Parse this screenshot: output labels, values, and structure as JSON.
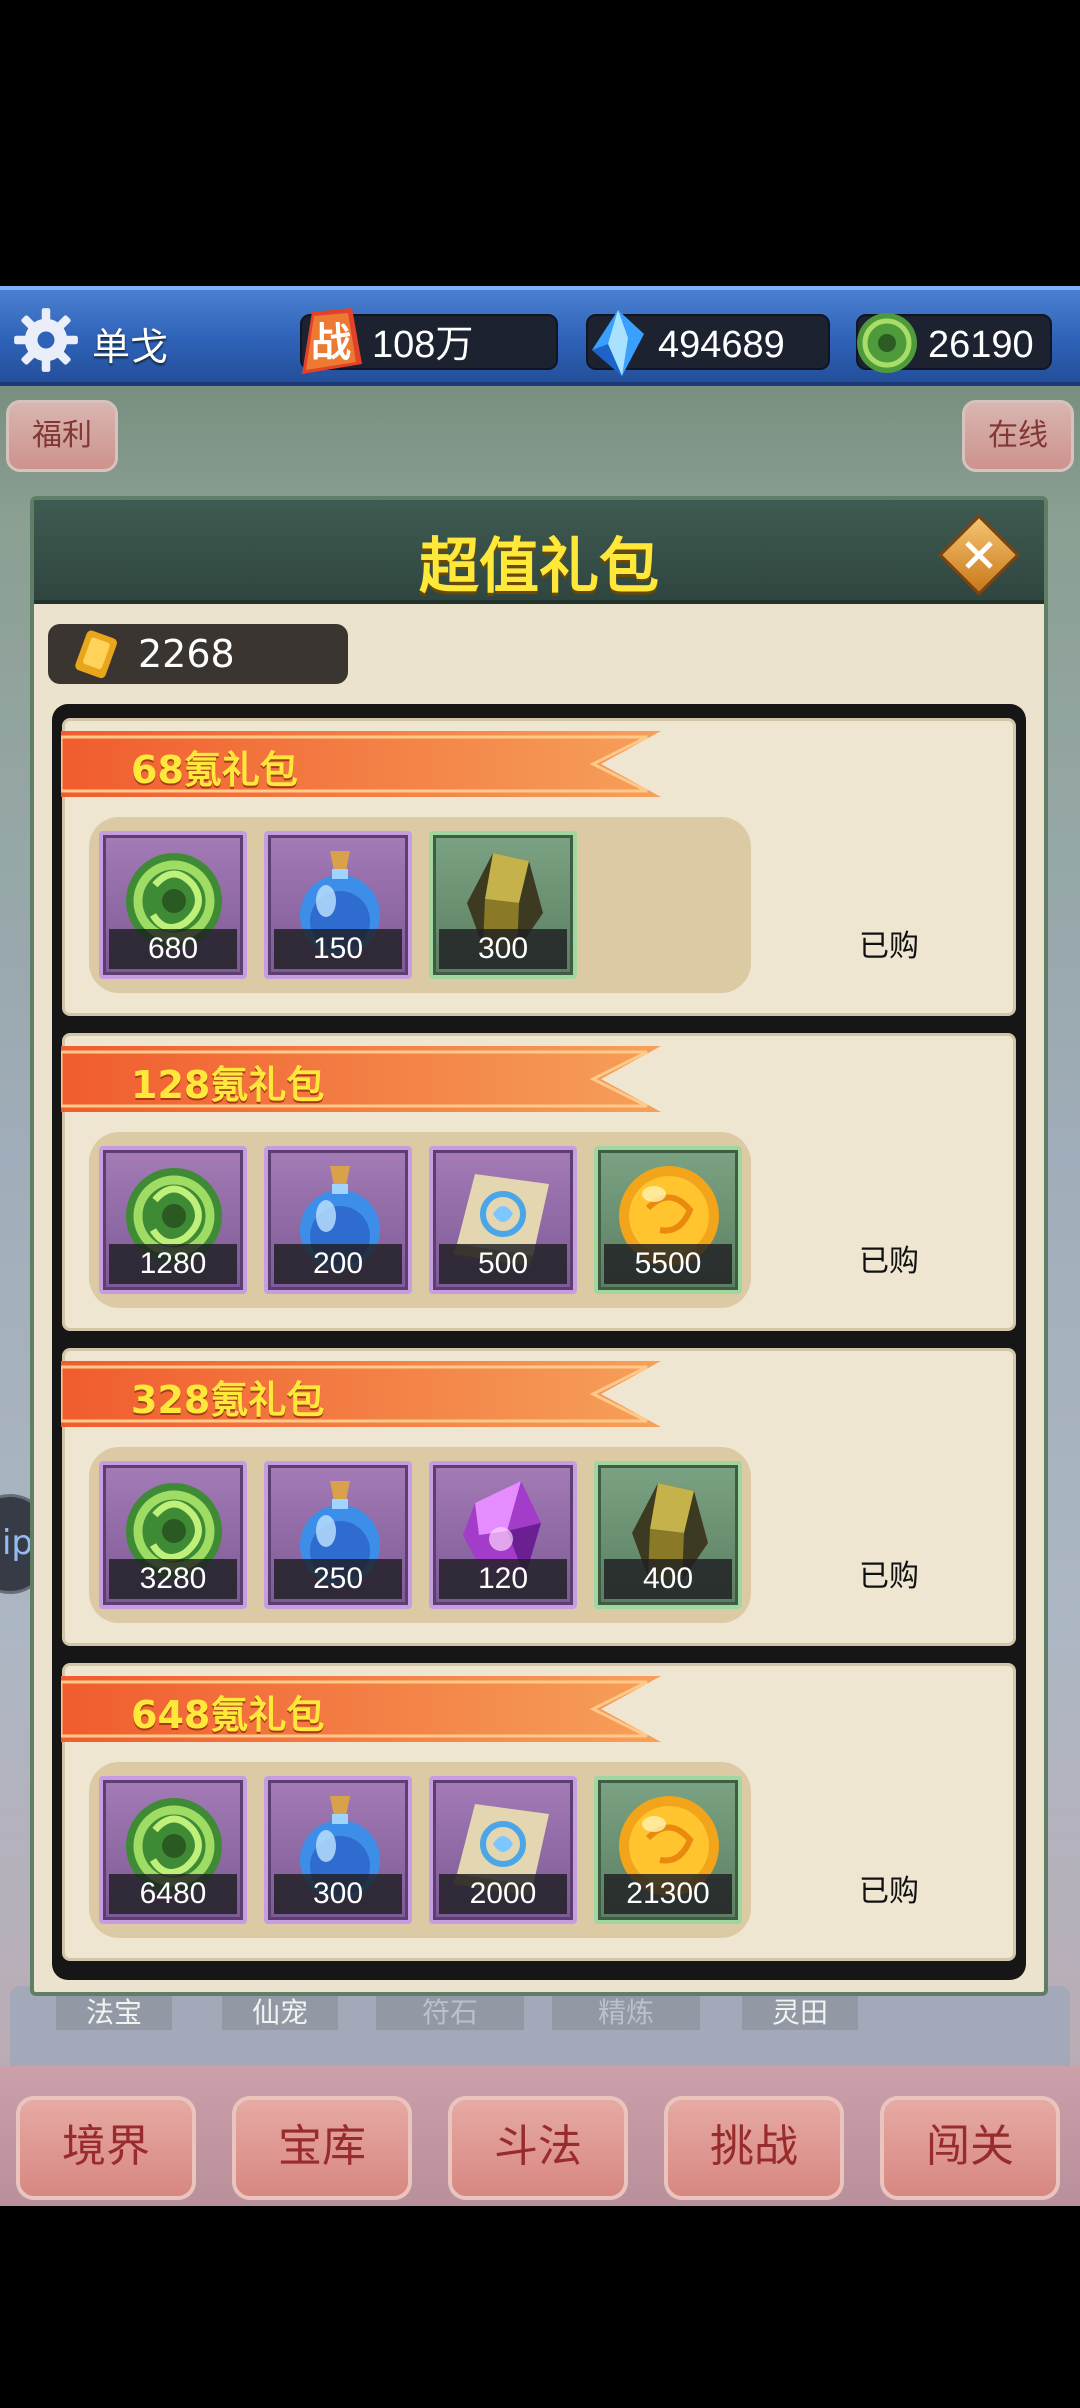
{
  "topbar": {
    "player_name": "单戈",
    "power_label": "战",
    "power_value": "108万",
    "diamonds_value": "494689",
    "jade_value": "26190"
  },
  "background": {
    "side_buttons_left": [
      "福利"
    ],
    "side_buttons_right": [
      "在线"
    ],
    "tabs": [
      "法宝",
      "仙宠",
      "符石",
      "精炼",
      "灵田"
    ],
    "bottom_nav": [
      "境界",
      "宝库",
      "斗法",
      "挑战",
      "闯关"
    ],
    "bubble_text": "ip"
  },
  "modal": {
    "title": "超值礼包",
    "currency_value": "2268",
    "packs": [
      {
        "name": "68氪礼包",
        "status": "已购",
        "items": [
          {
            "icon": "jade-coin-icon",
            "qty": "680",
            "frame": "purple"
          },
          {
            "icon": "blue-potion-icon",
            "qty": "150",
            "frame": "purple"
          },
          {
            "icon": "gold-ore-icon",
            "qty": "300",
            "frame": "green"
          }
        ]
      },
      {
        "name": "128氪礼包",
        "status": "已购",
        "items": [
          {
            "icon": "jade-coin-icon",
            "qty": "1280",
            "frame": "purple"
          },
          {
            "icon": "blue-potion-icon",
            "qty": "200",
            "frame": "purple"
          },
          {
            "icon": "scroll-icon",
            "qty": "500",
            "frame": "purple"
          },
          {
            "icon": "gold-orb-icon",
            "qty": "5500",
            "frame": "green"
          }
        ]
      },
      {
        "name": "328氪礼包",
        "status": "已购",
        "items": [
          {
            "icon": "jade-coin-icon",
            "qty": "3280",
            "frame": "purple"
          },
          {
            "icon": "blue-potion-icon",
            "qty": "250",
            "frame": "purple"
          },
          {
            "icon": "purple-crystal-icon",
            "qty": "120",
            "frame": "purple"
          },
          {
            "icon": "gold-ore-icon",
            "qty": "400",
            "frame": "green"
          }
        ]
      },
      {
        "name": "648氪礼包",
        "status": "已购",
        "items": [
          {
            "icon": "jade-coin-icon",
            "qty": "6480",
            "frame": "purple"
          },
          {
            "icon": "blue-potion-icon",
            "qty": "300",
            "frame": "purple"
          },
          {
            "icon": "scroll-icon",
            "qty": "2000",
            "frame": "purple"
          },
          {
            "icon": "gold-orb-icon",
            "qty": "21300",
            "frame": "green"
          }
        ]
      }
    ]
  },
  "colors": {
    "title_yellow": "#ffe83a",
    "ribbon_orange": "#f0683e",
    "topbar_blue": "#2e62b8"
  }
}
